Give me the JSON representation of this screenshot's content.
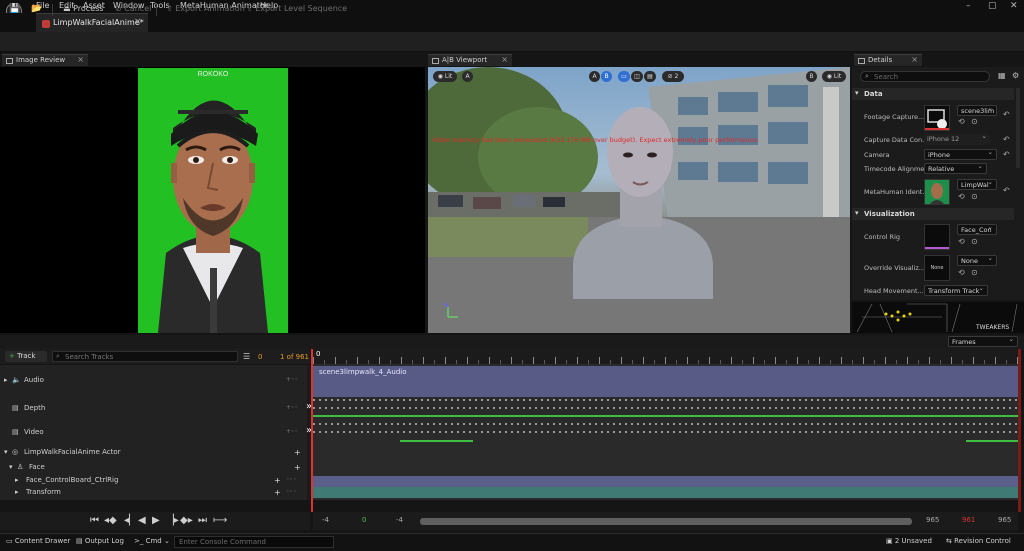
{
  "menu": [
    "File",
    "Edit",
    "Asset",
    "Window",
    "Tools",
    "MetaHuman Animator",
    "Help"
  ],
  "document_tab": "LimpWalkFacialAnime*",
  "toolbar": {
    "save_icon": "save-icon",
    "process": "Process",
    "cancel": "Cancel",
    "export_animation": "Export Animation",
    "export_level_sequence": "Export Level Sequence"
  },
  "panels": {
    "image_review": "Image Review",
    "viewport": "A|B Viewport",
    "details": "Details"
  },
  "viewport": {
    "lit_left": "Lit",
    "a_left": "A",
    "a_center": "A",
    "b_center": "B",
    "layout_count": "2",
    "b_right": "B",
    "lit_right": "Lit",
    "warning": "Video memory has been exhausted (633.176 MB over budget). Expect extremely poor performance."
  },
  "details": {
    "search_placeholder": "Search",
    "section_data": "Data",
    "section_visualization": "Visualization",
    "footage_capture_label": "Footage Capture...",
    "footage_capture_value": "scene3lim",
    "capture_data_label": "Capture Data Con...",
    "capture_data_value": "iPhone 12",
    "camera_label": "Camera",
    "camera_value": "iPhone",
    "timecode_label": "Timecode Alignme...",
    "timecode_value": "Relative",
    "metahuman_label": "MetaHuman Ident...",
    "metahuman_value": "LimpWal",
    "control_rig_label": "Control Rig",
    "control_rig_value": "Face_Con",
    "override_label": "Override Visualiz...",
    "override_value": "None",
    "override_thumb": "None",
    "head_movement_label": "Head Movement...",
    "head_movement_value": "Transform Track",
    "tweakers": "TWEAKERS"
  },
  "sequencer": {
    "add_track": "Track",
    "search_placeholder": "Search Tracks",
    "filter_count": "0",
    "frame_of": "1 of 961",
    "frames_dropdown": "Frames",
    "playhead_frame": "0",
    "tracks": [
      {
        "label": "Audio"
      },
      {
        "label": "Depth"
      },
      {
        "label": "Video"
      },
      {
        "label": "LimpWalkFacialAnime Actor"
      },
      {
        "label": "Face"
      },
      {
        "label": "Face_ControlBoard_CtrlRig"
      },
      {
        "label": "Transform"
      }
    ],
    "audio_clip": "scene3limpwalk_4_Audio",
    "range": {
      "start_outer": "-4",
      "start": "0",
      "view_start": "-4",
      "view_end": "965",
      "end": "961",
      "end_outer": "965"
    }
  },
  "statusbar": {
    "content_drawer": "Content Drawer",
    "output_log": "Output Log",
    "cmd": "Cmd",
    "console_placeholder": "Enter Console Command",
    "unsaved": "2 Unsaved",
    "revision_control": "Revision Control"
  },
  "colors": {
    "accent_blue": "#2f6fd3",
    "audio_track": "#585b86",
    "control_rig_track": "#5a5f8a",
    "transform_track": "#3f7a74",
    "warning_red": "#e22929",
    "greenscreen": "#23c323"
  }
}
